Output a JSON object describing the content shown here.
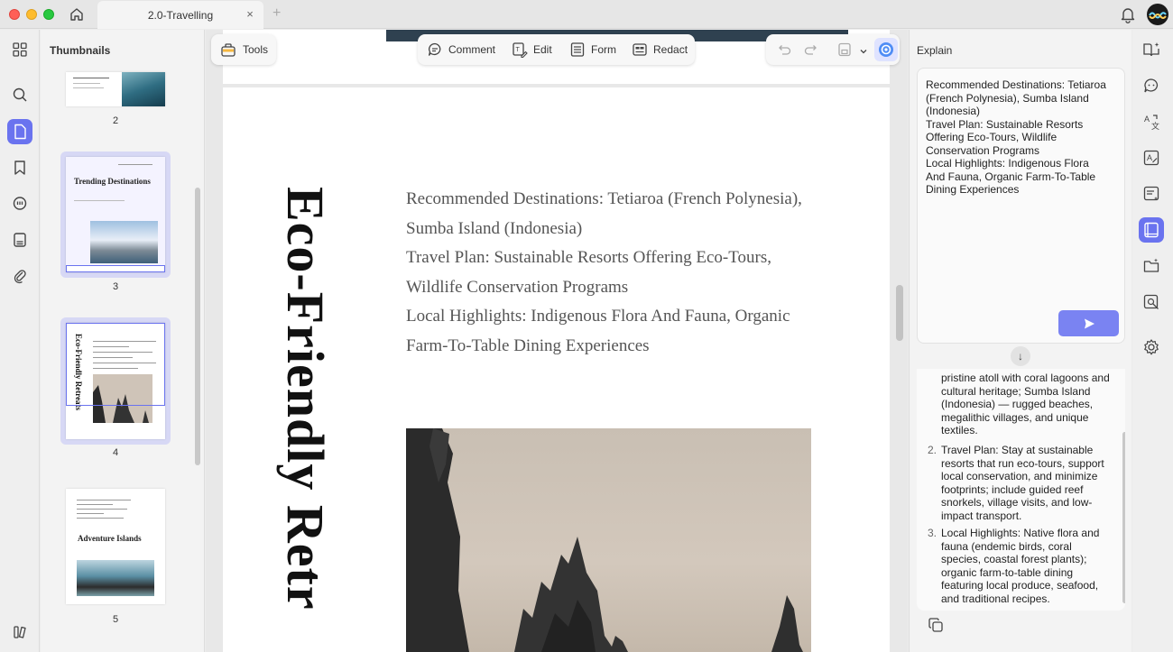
{
  "window": {
    "tab_title": "2.0-Travelling",
    "tab_close": "×",
    "tab_add": "+"
  },
  "left_rail": {
    "icons": [
      "grid-icon",
      "search-icon",
      "page-icon",
      "bookmark-icon",
      "comment-icon",
      "form-icon",
      "attachment-icon",
      "layers-icon"
    ]
  },
  "thumbnails": {
    "title": "Thumbnails",
    "pages": [
      {
        "number": "2"
      },
      {
        "number": "3",
        "heading": "Trending Destinations"
      },
      {
        "number": "4",
        "heading": "Eco-Friendly Retreats"
      },
      {
        "number": "5",
        "heading": "Adventure Islands"
      }
    ]
  },
  "toolbar": {
    "tools_label": "Tools",
    "comment_label": "Comment",
    "edit_label": "Edit",
    "form_label": "Form",
    "redact_label": "Redact"
  },
  "document": {
    "vertical_title": "Eco-Friendly Retr",
    "lines": [
      "Recommended Destinations: Tetiaroa (French Polynesia),",
      "Sumba Island (Indonesia)",
      "Travel Plan: Sustainable Resorts Offering Eco-Tours,",
      "Wildlife Conservation Programs",
      "Local Highlights: Indigenous Flora And Fauna, Organic",
      "Farm-To-Table Dining Experiences"
    ]
  },
  "explain_panel": {
    "title": "Explain",
    "input_lines": [
      "Recommended Destinations: Tetiaroa",
      "(French Polynesia), Sumba Island",
      "(Indonesia)",
      "Travel Plan: Sustainable Resorts",
      "Offering Eco-Tours, Wildlife",
      "Conservation Programs",
      "Local Highlights: Indigenous Flora",
      "And Fauna, Organic Farm-To-Table",
      "Dining Experiences"
    ],
    "answer_fragment": "pristine atoll with coral lagoons and cultural heritage; Sumba Island (Indonesia) — rugged beaches, megalithic villages, and unique textiles.",
    "answer_items": [
      {
        "num": "2.",
        "text": "Travel Plan: Stay at sustainable resorts that run eco-tours, support local conservation, and minimize footprints; include guided reef snorkels, village visits, and low-impact transport."
      },
      {
        "num": "3.",
        "text": "Local Highlights: Native flora and fauna (endemic birds, coral species, coastal forest plants); organic farm-to-table dining featuring local produce, seafood, and traditional recipes."
      }
    ],
    "scroll_down_glyph": "↓"
  },
  "right_rail": {
    "icons": [
      "book-ai-icon",
      "chat-ai-icon",
      "translate-icon",
      "grammar-icon",
      "summarize-icon",
      "explain-icon",
      "folder-ai-icon",
      "scan-icon",
      "settings-icon"
    ]
  },
  "colors": {
    "accent": "#6a73ef",
    "send_button": "#7a83f2"
  }
}
